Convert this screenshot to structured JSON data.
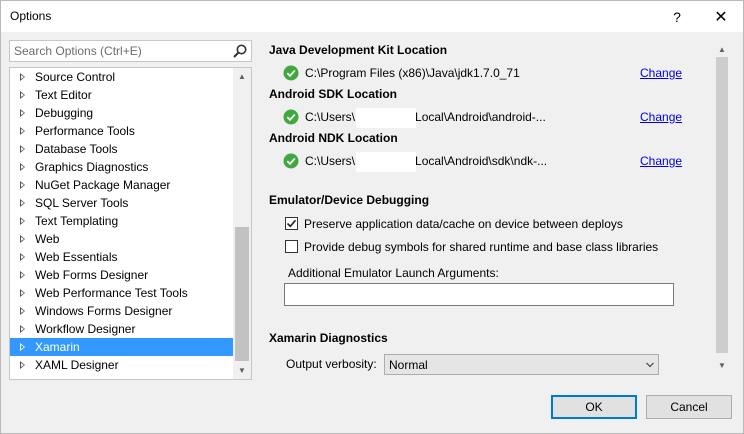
{
  "window": {
    "title": "Options",
    "help_glyph": "?",
    "close_glyph": "✕"
  },
  "search": {
    "placeholder": "Search Options (Ctrl+E)",
    "icon": "search-icon"
  },
  "tree": {
    "items": [
      {
        "label": "Source Control",
        "selected": false
      },
      {
        "label": "Text Editor",
        "selected": false
      },
      {
        "label": "Debugging",
        "selected": false
      },
      {
        "label": "Performance Tools",
        "selected": false
      },
      {
        "label": "Database Tools",
        "selected": false
      },
      {
        "label": "Graphics Diagnostics",
        "selected": false
      },
      {
        "label": "NuGet Package Manager",
        "selected": false
      },
      {
        "label": "SQL Server Tools",
        "selected": false
      },
      {
        "label": "Text Templating",
        "selected": false
      },
      {
        "label": "Web",
        "selected": false
      },
      {
        "label": "Web Essentials",
        "selected": false
      },
      {
        "label": "Web Forms Designer",
        "selected": false
      },
      {
        "label": "Web Performance Test Tools",
        "selected": false
      },
      {
        "label": "Windows Forms Designer",
        "selected": false
      },
      {
        "label": "Workflow Designer",
        "selected": false
      },
      {
        "label": "Xamarin",
        "selected": true
      },
      {
        "label": "XAML Designer",
        "selected": false
      }
    ]
  },
  "locations": {
    "jdk": {
      "heading": "Java Development Kit Location",
      "path": "C:\\Program Files (x86)\\Java\\jdk1.7.0_71",
      "change": "Change"
    },
    "sdk": {
      "heading": "Android SDK Location",
      "path": "C:\\Users\\I            \\AppData\\Local\\Android\\android-...",
      "change": "Change"
    },
    "ndk": {
      "heading": "Android NDK Location",
      "path": "C:\\Users\\I            \\AppData\\Local\\Android\\sdk\\ndk-...",
      "change": "Change"
    }
  },
  "emulator": {
    "heading": "Emulator/Device Debugging",
    "preserve_label": "Preserve application data/cache on device between deploys",
    "preserve_checked": true,
    "symbols_label": "Provide debug symbols for shared runtime and base class libraries",
    "symbols_checked": false,
    "args_label": "Additional Emulator Launch Arguments:",
    "args_value": ""
  },
  "diagnostics": {
    "heading": "Xamarin Diagnostics",
    "verbosity_label": "Output verbosity:",
    "verbosity_value": "Normal"
  },
  "buttons": {
    "ok": "OK",
    "cancel": "Cancel"
  },
  "colors": {
    "selection": "#3399ff",
    "link": "#0000ee",
    "ok_border": "#0078d7",
    "status_ok": "#3fa83f"
  }
}
